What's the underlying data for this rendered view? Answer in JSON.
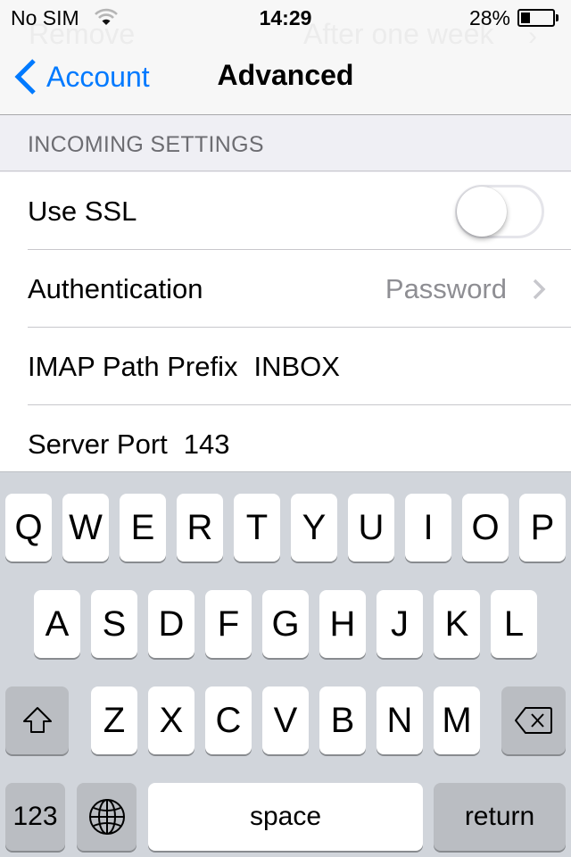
{
  "status_bar": {
    "carrier": "No SIM",
    "wifi_icon": "wifi-icon",
    "time": "14:29",
    "battery_percent_label": "28%",
    "battery_level": 0.28
  },
  "background_content": {
    "left": "Remove",
    "right": "After one week"
  },
  "nav": {
    "back_label": "Account",
    "title": "Advanced",
    "accent_color": "#007aff"
  },
  "section": {
    "header": "INCOMING SETTINGS",
    "rows": [
      {
        "label": "Use SSL",
        "type": "toggle",
        "on": false
      },
      {
        "label": "Authentication",
        "type": "disclosure",
        "value": "Password"
      },
      {
        "label": "IMAP Path Prefix",
        "type": "text-field",
        "value": "INBOX"
      },
      {
        "label": "Server Port",
        "type": "text-field",
        "value": "143"
      }
    ]
  },
  "keyboard": {
    "row1": [
      "Q",
      "W",
      "E",
      "R",
      "T",
      "Y",
      "U",
      "I",
      "O",
      "P"
    ],
    "row2": [
      "A",
      "S",
      "D",
      "F",
      "G",
      "H",
      "J",
      "K",
      "L"
    ],
    "row3": [
      "Z",
      "X",
      "C",
      "V",
      "B",
      "N",
      "M"
    ],
    "shift_icon": "shift-icon",
    "delete_icon": "delete-icon",
    "numbers_label": "123",
    "globe_icon": "globe-icon",
    "space_label": "space",
    "return_label": "return"
  }
}
